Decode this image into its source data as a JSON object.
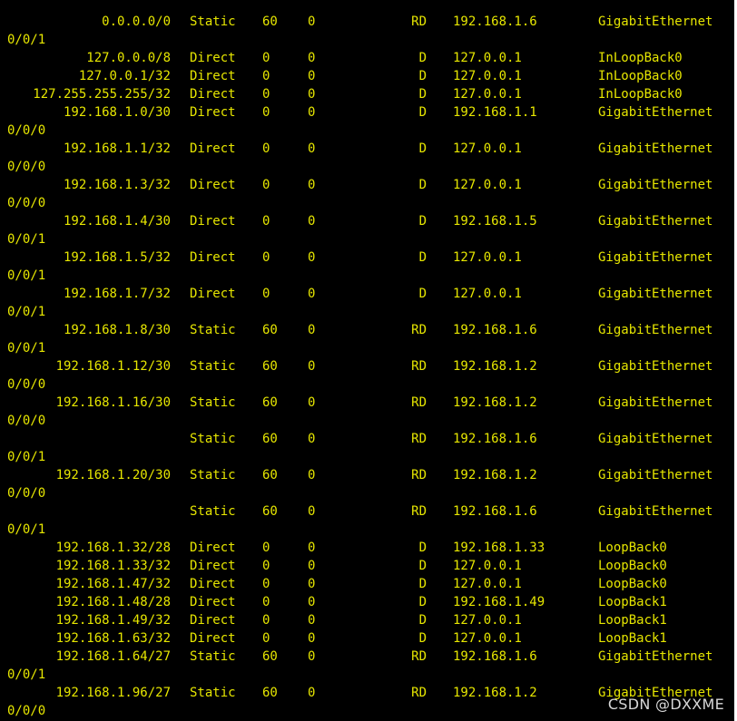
{
  "colors": {
    "background": "#000000",
    "text": "#e6e600",
    "watermark": "#d8d8d8",
    "border": "#ffffff"
  },
  "routes": [
    {
      "dest": "0.0.0.0/0",
      "proto": "Static",
      "pre": "60",
      "cost": "0",
      "flags": "RD",
      "nexthop": "192.168.1.6",
      "iface": "GigabitEthernet",
      "wrap": "0/0/1"
    },
    {
      "dest": "127.0.0.0/8",
      "proto": "Direct",
      "pre": "0",
      "cost": "0",
      "flags": "D",
      "nexthop": "127.0.0.1",
      "iface": "InLoopBack0",
      "wrap": ""
    },
    {
      "dest": "127.0.0.1/32",
      "proto": "Direct",
      "pre": "0",
      "cost": "0",
      "flags": "D",
      "nexthop": "127.0.0.1",
      "iface": "InLoopBack0",
      "wrap": ""
    },
    {
      "dest": "127.255.255.255/32",
      "proto": "Direct",
      "pre": "0",
      "cost": "0",
      "flags": "D",
      "nexthop": "127.0.0.1",
      "iface": "InLoopBack0",
      "wrap": ""
    },
    {
      "dest": "192.168.1.0/30",
      "proto": "Direct",
      "pre": "0",
      "cost": "0",
      "flags": "D",
      "nexthop": "192.168.1.1",
      "iface": "GigabitEthernet",
      "wrap": "0/0/0"
    },
    {
      "dest": "192.168.1.1/32",
      "proto": "Direct",
      "pre": "0",
      "cost": "0",
      "flags": "D",
      "nexthop": "127.0.0.1",
      "iface": "GigabitEthernet",
      "wrap": "0/0/0"
    },
    {
      "dest": "192.168.1.3/32",
      "proto": "Direct",
      "pre": "0",
      "cost": "0",
      "flags": "D",
      "nexthop": "127.0.0.1",
      "iface": "GigabitEthernet",
      "wrap": "0/0/0"
    },
    {
      "dest": "192.168.1.4/30",
      "proto": "Direct",
      "pre": "0",
      "cost": "0",
      "flags": "D",
      "nexthop": "192.168.1.5",
      "iface": "GigabitEthernet",
      "wrap": "0/0/1"
    },
    {
      "dest": "192.168.1.5/32",
      "proto": "Direct",
      "pre": "0",
      "cost": "0",
      "flags": "D",
      "nexthop": "127.0.0.1",
      "iface": "GigabitEthernet",
      "wrap": "0/0/1"
    },
    {
      "dest": "192.168.1.7/32",
      "proto": "Direct",
      "pre": "0",
      "cost": "0",
      "flags": "D",
      "nexthop": "127.0.0.1",
      "iface": "GigabitEthernet",
      "wrap": "0/0/1"
    },
    {
      "dest": "192.168.1.8/30",
      "proto": "Static",
      "pre": "60",
      "cost": "0",
      "flags": "RD",
      "nexthop": "192.168.1.6",
      "iface": "GigabitEthernet",
      "wrap": "0/0/1"
    },
    {
      "dest": "192.168.1.12/30",
      "proto": "Static",
      "pre": "60",
      "cost": "0",
      "flags": "RD",
      "nexthop": "192.168.1.2",
      "iface": "GigabitEthernet",
      "wrap": "0/0/0"
    },
    {
      "dest": "192.168.1.16/30",
      "proto": "Static",
      "pre": "60",
      "cost": "0",
      "flags": "RD",
      "nexthop": "192.168.1.2",
      "iface": "GigabitEthernet",
      "wrap": "0/0/0"
    },
    {
      "dest": "",
      "proto": "Static",
      "pre": "60",
      "cost": "0",
      "flags": "RD",
      "nexthop": "192.168.1.6",
      "iface": "GigabitEthernet",
      "wrap": "0/0/1"
    },
    {
      "dest": "192.168.1.20/30",
      "proto": "Static",
      "pre": "60",
      "cost": "0",
      "flags": "RD",
      "nexthop": "192.168.1.2",
      "iface": "GigabitEthernet",
      "wrap": "0/0/0"
    },
    {
      "dest": "",
      "proto": "Static",
      "pre": "60",
      "cost": "0",
      "flags": "RD",
      "nexthop": "192.168.1.6",
      "iface": "GigabitEthernet",
      "wrap": "0/0/1"
    },
    {
      "dest": "192.168.1.32/28",
      "proto": "Direct",
      "pre": "0",
      "cost": "0",
      "flags": "D",
      "nexthop": "192.168.1.33",
      "iface": "LoopBack0",
      "wrap": ""
    },
    {
      "dest": "192.168.1.33/32",
      "proto": "Direct",
      "pre": "0",
      "cost": "0",
      "flags": "D",
      "nexthop": "127.0.0.1",
      "iface": "LoopBack0",
      "wrap": ""
    },
    {
      "dest": "192.168.1.47/32",
      "proto": "Direct",
      "pre": "0",
      "cost": "0",
      "flags": "D",
      "nexthop": "127.0.0.1",
      "iface": "LoopBack0",
      "wrap": ""
    },
    {
      "dest": "192.168.1.48/28",
      "proto": "Direct",
      "pre": "0",
      "cost": "0",
      "flags": "D",
      "nexthop": "192.168.1.49",
      "iface": "LoopBack1",
      "wrap": ""
    },
    {
      "dest": "192.168.1.49/32",
      "proto": "Direct",
      "pre": "0",
      "cost": "0",
      "flags": "D",
      "nexthop": "127.0.0.1",
      "iface": "LoopBack1",
      "wrap": ""
    },
    {
      "dest": "192.168.1.63/32",
      "proto": "Direct",
      "pre": "0",
      "cost": "0",
      "flags": "D",
      "nexthop": "127.0.0.1",
      "iface": "LoopBack1",
      "wrap": ""
    },
    {
      "dest": "192.168.1.64/27",
      "proto": "Static",
      "pre": "60",
      "cost": "0",
      "flags": "RD",
      "nexthop": "192.168.1.6",
      "iface": "GigabitEthernet",
      "wrap": "0/0/1"
    },
    {
      "dest": "192.168.1.96/27",
      "proto": "Static",
      "pre": "60",
      "cost": "0",
      "flags": "RD",
      "nexthop": "192.168.1.2",
      "iface": "GigabitEthernet",
      "wrap": "0/0/0"
    }
  ],
  "watermark": "CSDN @DXXME"
}
